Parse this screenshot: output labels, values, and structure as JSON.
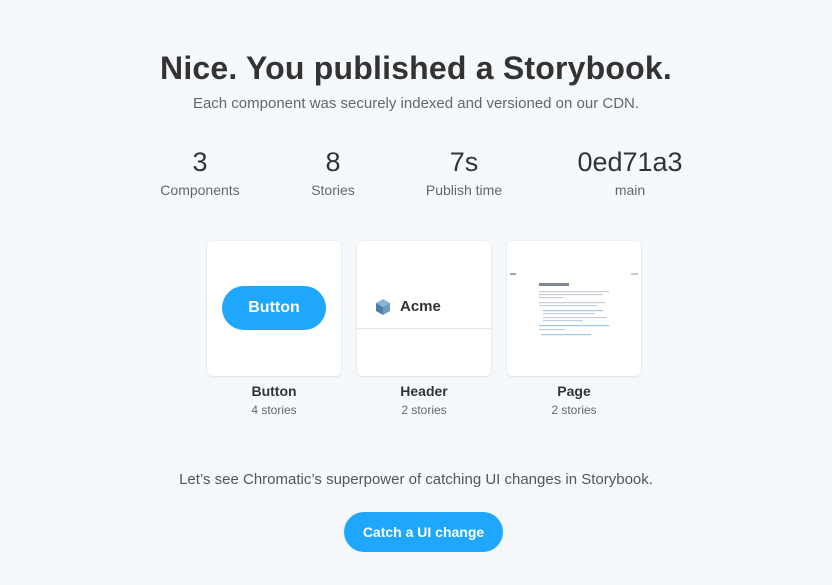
{
  "header": {
    "title": "Nice. You published a Storybook.",
    "subtitle": "Each component was securely indexed and versioned on our CDN."
  },
  "stats": [
    {
      "value": "3",
      "label": "Components"
    },
    {
      "value": "8",
      "label": "Stories"
    },
    {
      "value": "7s",
      "label": "Publish time"
    },
    {
      "value": "0ed71a3",
      "label": "main"
    }
  ],
  "components": [
    {
      "name": "Button",
      "count": "4 stories",
      "preview_label": "Button"
    },
    {
      "name": "Header",
      "count": "2 stories",
      "preview_label": "Acme"
    },
    {
      "name": "Page",
      "count": "2 stories"
    }
  ],
  "cta": {
    "text": "Let’s see Chromatic’s superpower of catching UI changes in Storybook.",
    "button_label": "Catch a UI change"
  },
  "colors": {
    "accent": "#1ea7fd",
    "background": "#f6f9fc"
  }
}
